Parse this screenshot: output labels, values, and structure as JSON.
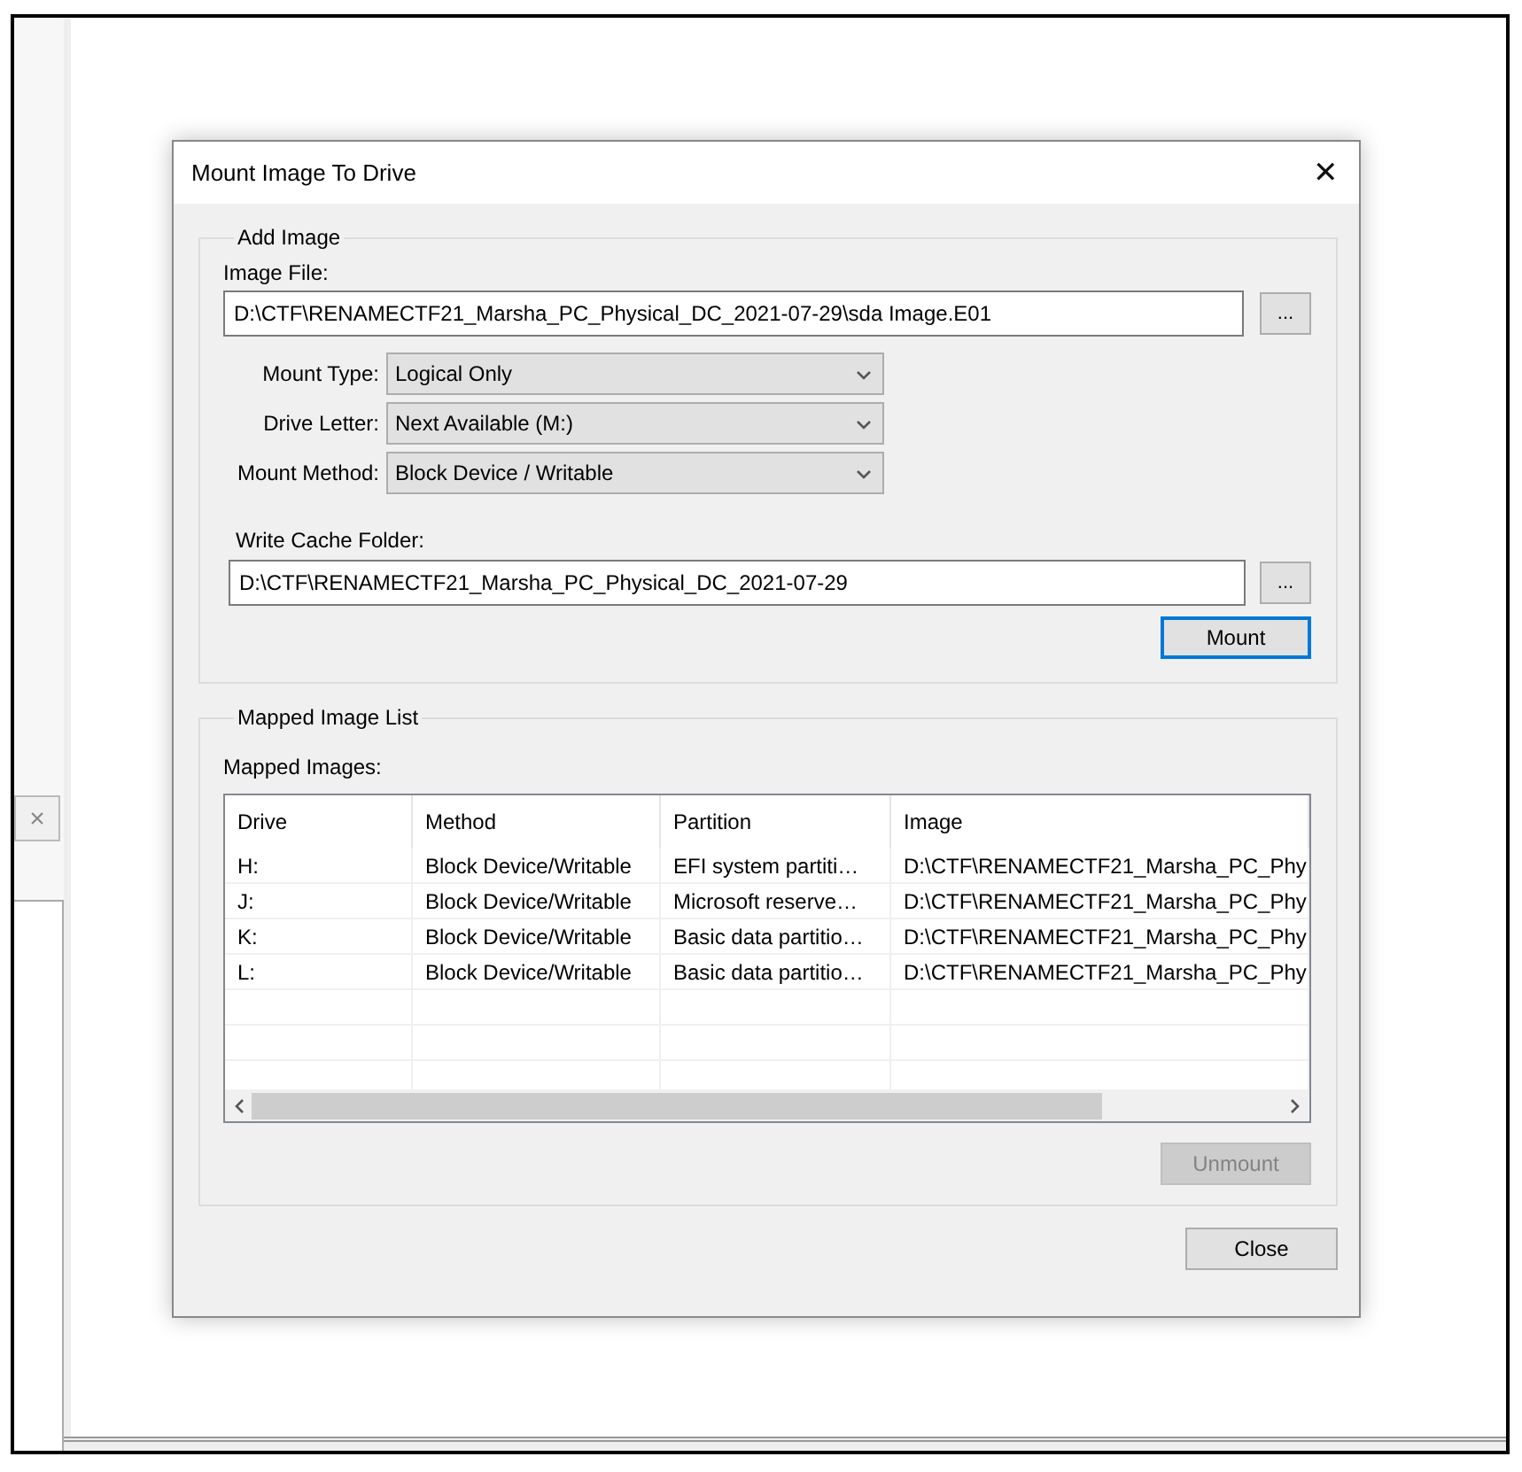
{
  "background_window": {
    "close_symbol": "×"
  },
  "dialog": {
    "title": "Mount Image To Drive",
    "close_symbol": "✕"
  },
  "add_image": {
    "legend": "Add Image",
    "image_file": {
      "label": "Image File:",
      "value": "D:\\CTF\\RENAMECTF21_Marsha_PC_Physical_DC_2021-07-29\\sda Image.E01",
      "browse": "..."
    },
    "options": [
      {
        "label": "Mount Type:",
        "value": "Logical Only"
      },
      {
        "label": "Drive Letter:",
        "value": "Next Available (M:)"
      },
      {
        "label": "Mount Method:",
        "value": "Block Device / Writable"
      }
    ],
    "write_cache": {
      "label": "Write Cache Folder:",
      "value": "D:\\CTF\\RENAMECTF21_Marsha_PC_Physical_DC_2021-07-29",
      "browse": "..."
    },
    "mount_button": {
      "label": "Mount",
      "default": true,
      "disabled": false
    }
  },
  "mapped_image_list": {
    "legend": "Mapped Image List",
    "label": "Mapped Images:",
    "table": {
      "columns": [
        "Drive",
        "Method",
        "Partition",
        "Image"
      ],
      "rows": [
        [
          "H:",
          "Block Device/Writable",
          "EFI system partiti…",
          "D:\\CTF\\RENAMECTF21_Marsha_PC_Phy"
        ],
        [
          "J:",
          "Block Device/Writable",
          "Microsoft reserve…",
          "D:\\CTF\\RENAMECTF21_Marsha_PC_Phy"
        ],
        [
          "K:",
          "Block Device/Writable",
          "Basic data partitio…",
          "D:\\CTF\\RENAMECTF21_Marsha_PC_Phy"
        ],
        [
          "L:",
          "Block Device/Writable",
          "Basic data partitio…",
          "D:\\CTF\\RENAMECTF21_Marsha_PC_Phy"
        ]
      ]
    },
    "unmount_button": {
      "label": "Unmount",
      "default": false,
      "disabled": true
    }
  },
  "close_button": {
    "label": "Close",
    "default": false,
    "disabled": false
  }
}
